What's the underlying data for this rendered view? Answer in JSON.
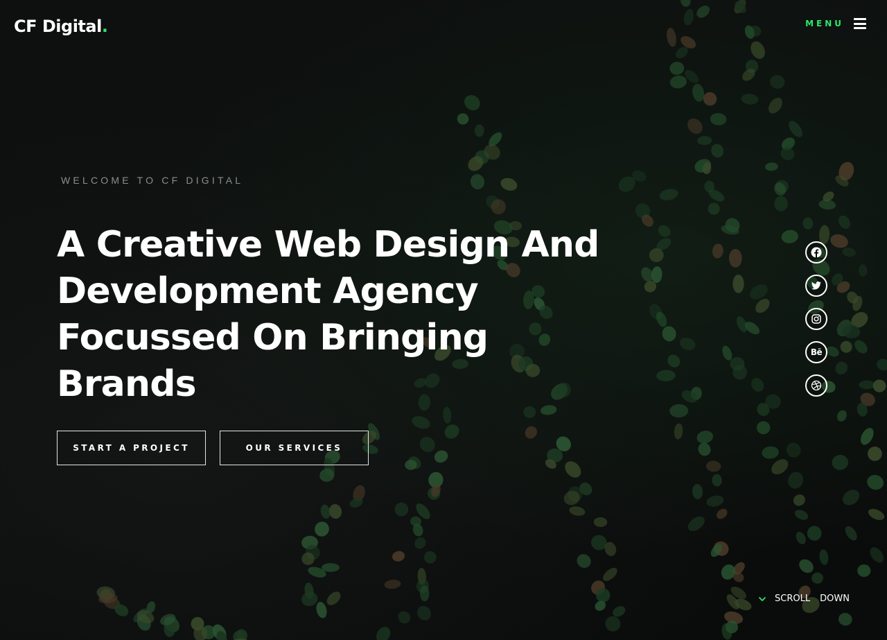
{
  "colors": {
    "accent": "#2ee56b",
    "background": "#0b0d0c",
    "text": "#ffffff",
    "muted": "#8b8e8c"
  },
  "header": {
    "logo_text": "CF Digital",
    "logo_dot": ".",
    "menu_label": "MENU",
    "menu_icon": "hamburger-icon"
  },
  "hero": {
    "kicker": "WELCOME TO CF DIGITAL",
    "headline_lines": [
      "A Creative Web Design And",
      "Development Agency",
      "Focussed On Bringing",
      "Brands"
    ],
    "buttons": {
      "start_project": "START A PROJECT",
      "our_services": "OUR SERVICES"
    }
  },
  "socials": [
    {
      "icon": "facebook-icon"
    },
    {
      "icon": "twitter-icon"
    },
    {
      "icon": "instagram-icon"
    },
    {
      "icon": "behance-icon",
      "glyph": "Bē"
    },
    {
      "icon": "dribbble-icon"
    }
  ],
  "scroll": {
    "icon": "chevron-down-icon",
    "word1": "SCROLL",
    "word2": "DOWN"
  }
}
